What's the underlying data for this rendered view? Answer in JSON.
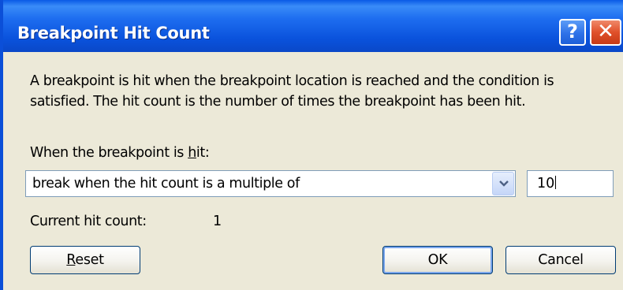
{
  "window": {
    "title": "Breakpoint Hit Count",
    "help_label": "?",
    "close_label": "✕"
  },
  "description": {
    "line1": "A breakpoint is hit when the breakpoint location is reached and the condition is",
    "line2": "satisfied. The hit count is the number of times the breakpoint has been hit."
  },
  "hit_condition": {
    "label_before": "When the breakpoint is ",
    "label_mnemonic": "h",
    "label_after": "it:",
    "selected_option": "break when the hit count is a multiple of",
    "count_value": "10"
  },
  "current": {
    "label": "Current hit count:",
    "value": "1"
  },
  "buttons": {
    "reset_mnemonic": "R",
    "reset_rest": "eset",
    "ok": "OK",
    "cancel": "Cancel"
  },
  "colors": {
    "titlebar": "#0a52dc",
    "dialog_bg": "#ece9d8",
    "close_button": "#e0502a"
  }
}
